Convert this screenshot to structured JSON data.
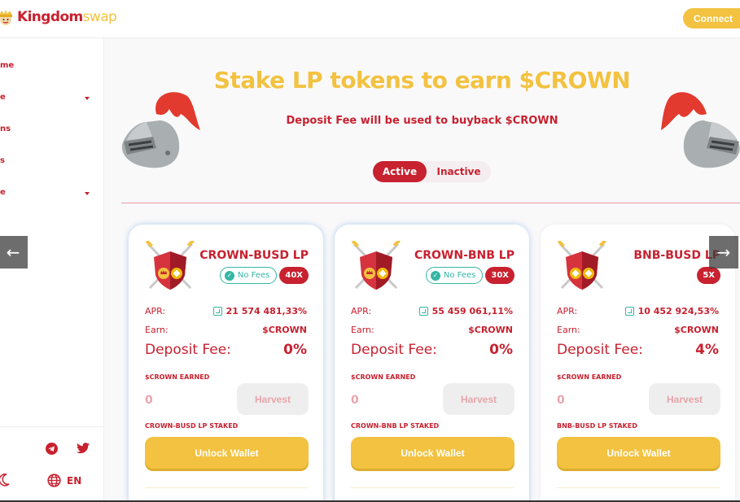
{
  "header": {
    "logo": {
      "part1": "Kingdom",
      "part2": "swap"
    },
    "connect_label": "Connect"
  },
  "sidebar": {
    "items": [
      {
        "label": "me",
        "has_caret": false
      },
      {
        "label": "e",
        "has_caret": true
      },
      {
        "label": "ns",
        "has_caret": false
      },
      {
        "label": "s",
        "has_caret": false
      },
      {
        "label": "e",
        "has_caret": true
      }
    ],
    "language": "EN",
    "icons": [
      "telegram-icon",
      "twitter-icon",
      "moon-icon",
      "globe-icon"
    ]
  },
  "banner": {
    "title": "Stake LP tokens to earn $CROWN",
    "subtitle": "Deposit Fee will be used to buyback $CROWN",
    "tabs": {
      "active": "Active",
      "inactive": "Inactive"
    }
  },
  "farms": [
    {
      "title": "CROWN-BUSD LP",
      "no_fees": true,
      "no_fees_label": "No Fees",
      "multiplier": "40X",
      "apr_label": "APR:",
      "apr": "21 574 481,33%",
      "earn_label": "Earn:",
      "earn": "$CROWN",
      "fee_label": "Deposit Fee:",
      "fee": "0%",
      "earned_label": "$CROWN EARNED",
      "earned_value": "0",
      "harvest_label": "Harvest",
      "staked_label": "CROWN-BUSD LP STAKED",
      "unlock_label": "Unlock Wallet",
      "tokens": [
        "crown",
        "busd"
      ]
    },
    {
      "title": "CROWN-BNB LP",
      "no_fees": true,
      "no_fees_label": "No Fees",
      "multiplier": "30X",
      "apr_label": "APR:",
      "apr": "55 459 061,11%",
      "earn_label": "Earn:",
      "earn": "$CROWN",
      "fee_label": "Deposit Fee:",
      "fee": "0%",
      "earned_label": "$CROWN EARNED",
      "earned_value": "0",
      "harvest_label": "Harvest",
      "staked_label": "CROWN-BNB LP STAKED",
      "unlock_label": "Unlock Wallet",
      "tokens": [
        "crown",
        "bnb"
      ]
    },
    {
      "title": "BNB-BUSD LP",
      "no_fees": false,
      "no_fees_label": "",
      "multiplier": "5X",
      "apr_label": "APR:",
      "apr": "10 452 924,53%",
      "earn_label": "Earn:",
      "earn": "$CROWN",
      "fee_label": "Deposit Fee:",
      "fee": "4%",
      "earned_label": "$CROWN EARNED",
      "earned_value": "0",
      "harvest_label": "Harvest",
      "staked_label": "BNB-BUSD LP STAKED",
      "unlock_label": "Unlock Wallet",
      "tokens": [
        "bnb",
        "busd"
      ]
    }
  ],
  "carousel": {
    "prev": "←",
    "next": "→"
  },
  "colors": {
    "brand_red": "#c8212f",
    "brand_gold": "#f2c240",
    "teal": "#35b6a3"
  }
}
